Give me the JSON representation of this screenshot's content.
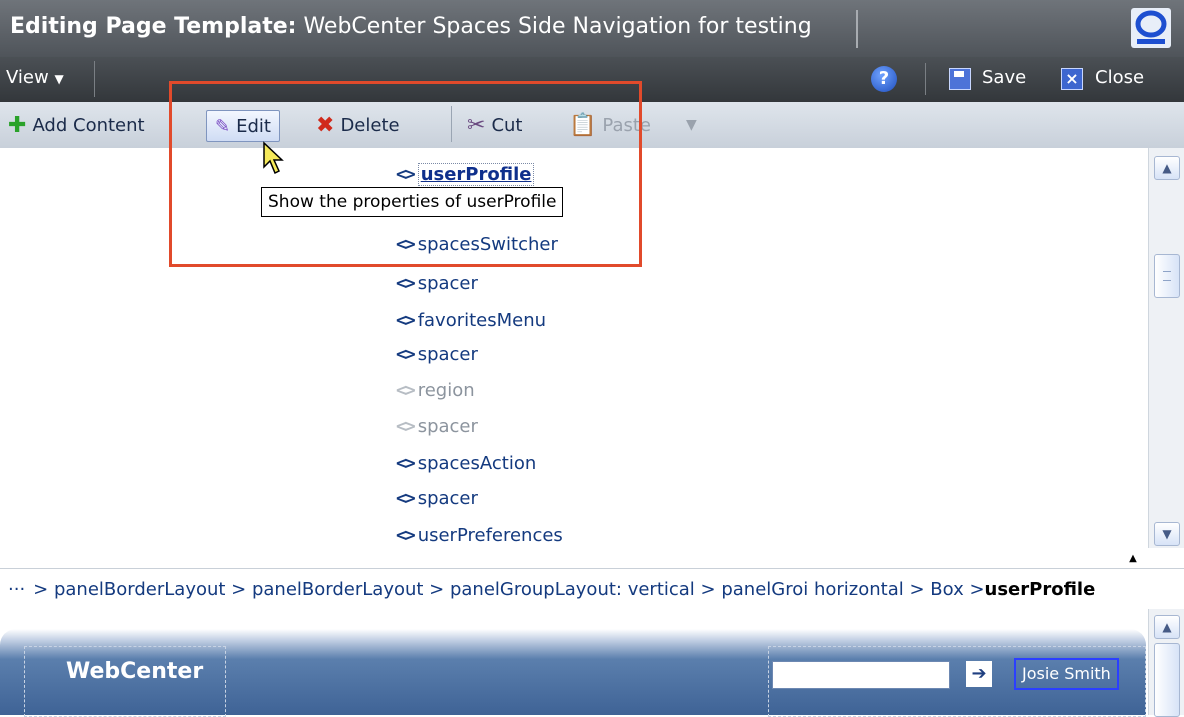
{
  "header": {
    "title_prefix": "Editing Page Template:",
    "title_name": " WebCenter Spaces Side Navigation for testing"
  },
  "viewbar": {
    "view_label": "View",
    "save_label": "Save",
    "close_label": "Close"
  },
  "toolbar": {
    "add_label": "Add Content",
    "edit_label": "Edit",
    "delete_label": "Delete",
    "cut_label": "Cut",
    "paste_label": "Paste"
  },
  "tooltip": {
    "text": "Show the properties of userProfile"
  },
  "tree": {
    "items": [
      {
        "label": "userProfile"
      },
      {
        "label": "spacesSwitcher"
      },
      {
        "label": "spacer"
      },
      {
        "label": "favoritesMenu"
      },
      {
        "label": "spacer"
      },
      {
        "label": "region"
      },
      {
        "label": "spacer"
      },
      {
        "label": "spacesAction"
      },
      {
        "label": "spacer"
      },
      {
        "label": "userPreferences"
      }
    ]
  },
  "breadcrumb": {
    "dots": "···",
    "path": " > panelBorderLayout > panelBorderLayout > panelGroupLayout: vertical > panelGroi horizontal > Box > ",
    "current": "userProfile"
  },
  "preview": {
    "app_name": "WebCenter",
    "user_name": "Josie Smith",
    "go_symbol": "➔"
  },
  "colors": {
    "highlight": "#e14a2b",
    "header_bg": "#5a5f65",
    "link": "#143a7f"
  }
}
